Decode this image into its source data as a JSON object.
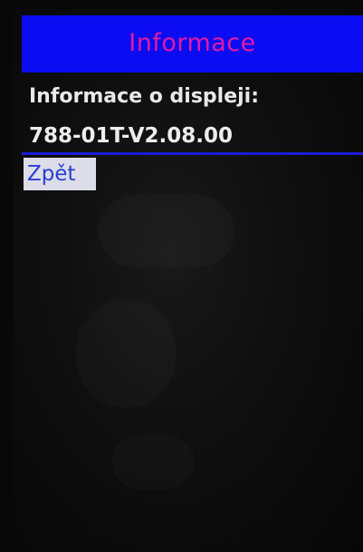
{
  "header": {
    "title": "Informace"
  },
  "info": {
    "label": "Informace o displeji:",
    "value": "788-01T-V2.08.00"
  },
  "actions": {
    "back_label": "Zpět"
  },
  "colors": {
    "header_bg": "#0c0cf2",
    "header_text": "#e11aa4",
    "background": "#0a0a0a",
    "divider": "#1b1bd8",
    "button_bg": "#dcdde8",
    "button_text": "#2a3fd2"
  }
}
